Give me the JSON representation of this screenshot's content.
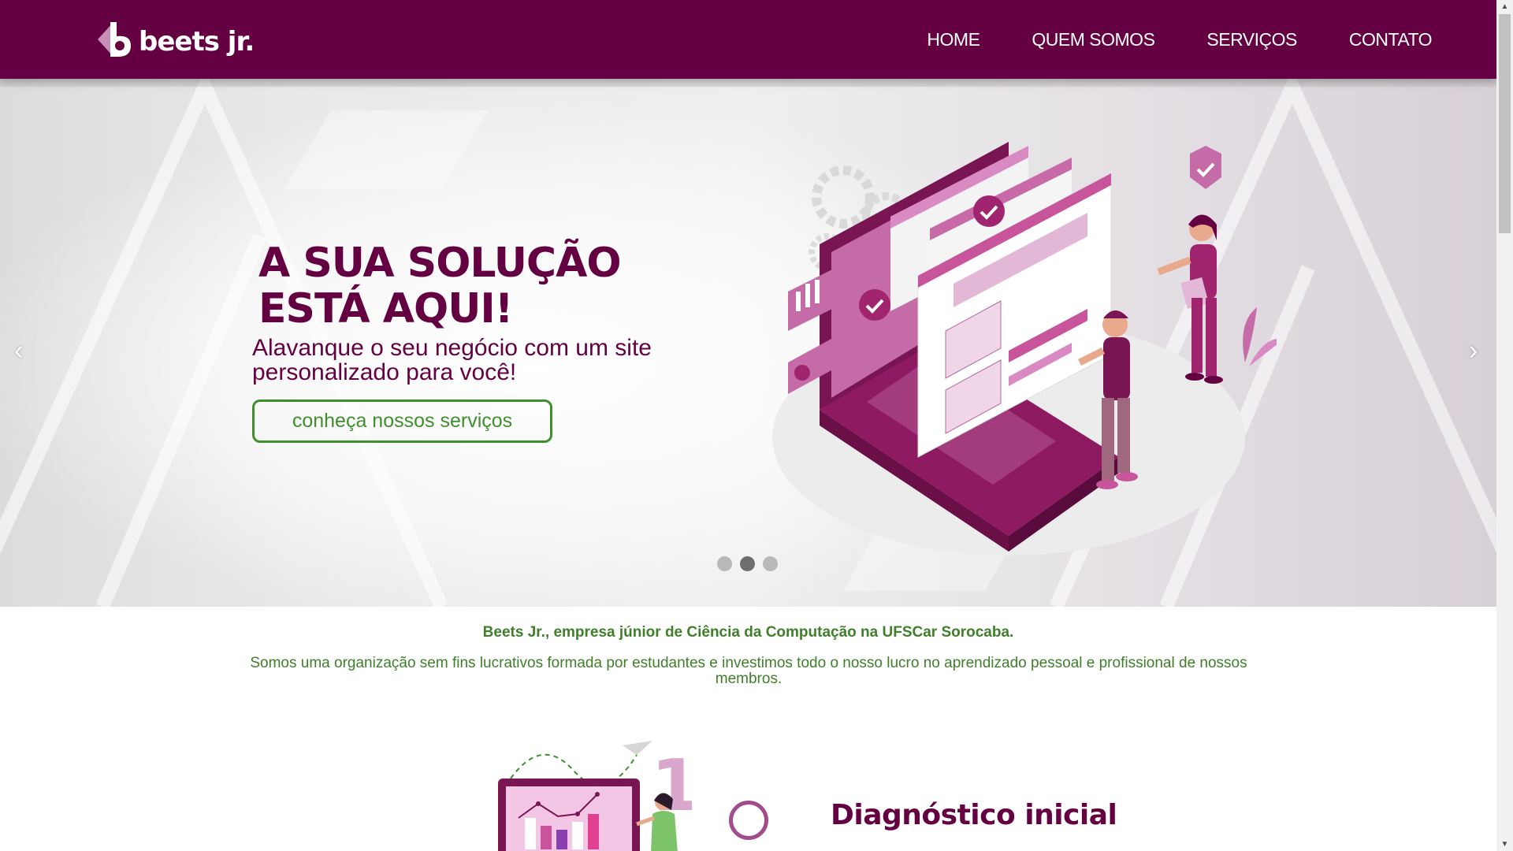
{
  "nav": {
    "logo_text": "beets jr.",
    "items": [
      {
        "label": "HOME"
      },
      {
        "label": "QUEM SOMOS"
      },
      {
        "label": "SERVIÇOS"
      },
      {
        "label": "CONTATO"
      }
    ]
  },
  "hero": {
    "title": "A SUA SOLUÇÃO ESTÁ AQUI!",
    "subtitle": "Alavanque o seu negócio com um site personalizado para você!",
    "button_label": "conheça nossos serviços",
    "prev_icon": "‹",
    "next_icon": "›",
    "slide_count": 3,
    "active_slide": 2
  },
  "about": {
    "title": "Beets Jr., empresa júnior de Ciência da Computação na UFSCar Sorocaba.",
    "text": "Somos uma organização sem fins lucrativos formada por estudantes e investimos todo o nosso lucro no aprendizado pessoal e profissional de nossos membros."
  },
  "step": {
    "number": "1",
    "title": "Diagnóstico inicial"
  },
  "colors": {
    "brand": "#640041",
    "accent_pink": "#a24c8c",
    "green": "#3f8f2c"
  }
}
